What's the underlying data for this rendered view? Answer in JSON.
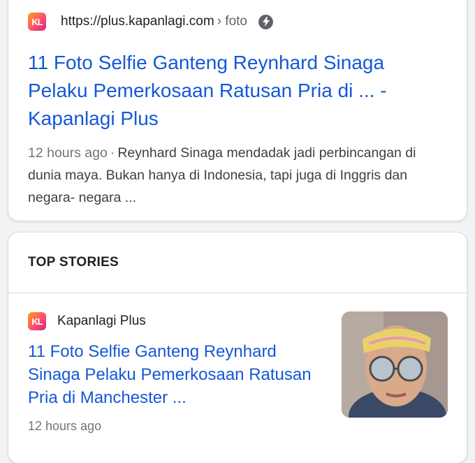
{
  "result": {
    "favicon_text": "KL",
    "url": "https://plus.kapanlagi.com",
    "crumb": "› foto",
    "amp_icon": "lightning-bolt-icon",
    "title": "11 Foto Selfie Ganteng Reynhard Sinaga Pelaku Pemerkosaan Ratusan Pria di ... - Kapanlagi Plus",
    "time": "12 hours ago",
    "separator": "·",
    "snippet": "Reynhard Sinaga mendadak jadi perbincangan di dunia maya. Bukan hanya di Indonesia, tapi juga di Inggris dan negara- negara ..."
  },
  "top_stories": {
    "header": "TOP STORIES",
    "story": {
      "favicon_text": "KL",
      "source": "Kapanlagi Plus",
      "title": "11 Foto Selfie Ganteng Reynhard Sinaga Pelaku Pemerkosaan Ratusan Pria di Manchester ...",
      "time": "12 hours ago"
    }
  },
  "colors": {
    "link": "#1558d6",
    "meta": "#70757a",
    "card": "#ffffff",
    "background": "#f1f3f4"
  }
}
